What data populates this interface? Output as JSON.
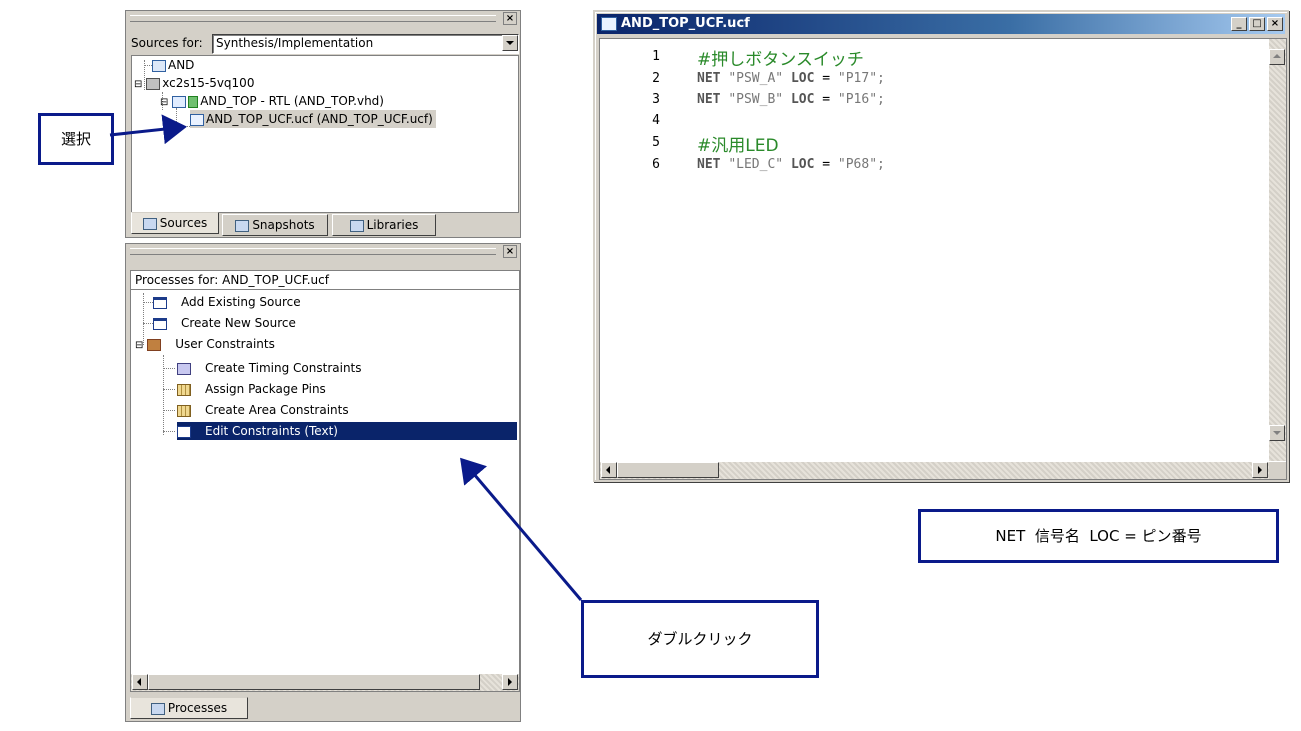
{
  "sources_panel": {
    "sources_for_label": "Sources for:",
    "sources_for_value": "Synthesis/Implementation",
    "tree": [
      {
        "label": "AND",
        "icon": "file-icon"
      },
      {
        "label": "xc2s15-5vq100",
        "icon": "chip-icon"
      },
      {
        "label": "AND_TOP - RTL (AND_TOP.vhd)",
        "icon": "vhdl-module-icon"
      },
      {
        "label": "AND_TOP_UCF.ucf (AND_TOP_UCF.ucf)",
        "icon": "ucf-file-icon",
        "selected": true
      }
    ],
    "tabs": [
      {
        "label": "Sources",
        "icon": "sources-icon",
        "active": true
      },
      {
        "label": "Snapshots",
        "icon": "snapshots-icon"
      },
      {
        "label": "Libraries",
        "icon": "libraries-icon"
      }
    ]
  },
  "processes_panel": {
    "header": "Processes for: AND_TOP_UCF.ucf",
    "items": [
      {
        "label": "Add Existing Source",
        "icon": "window-icon"
      },
      {
        "label": "Create New Source",
        "icon": "window-icon"
      },
      {
        "label": "User Constraints",
        "icon": "tools-icon"
      },
      {
        "label": "Create Timing Constraints",
        "icon": "timing-icon"
      },
      {
        "label": "Assign Package Pins",
        "icon": "grid-icon"
      },
      {
        "label": "Create Area Constraints",
        "icon": "grid-icon"
      },
      {
        "label": "Edit Constraints (Text)",
        "icon": "document-icon",
        "selected": true
      }
    ],
    "tab": "Processes"
  },
  "editor": {
    "title": "AND_TOP_UCF.ucf",
    "lines": [
      {
        "num": "1",
        "text": "#押しボタンスイッチ"
      },
      {
        "num": "2",
        "kw1": "NET",
        "str1": "\"PSW_A\"",
        "kw2": "LOC",
        "eq": "=",
        "str2": "\"P17\";"
      },
      {
        "num": "3",
        "kw1": "NET",
        "str1": "\"PSW_B\"",
        "kw2": "LOC",
        "eq": "=",
        "str2": "\"P16\";"
      },
      {
        "num": "4",
        "text": ""
      },
      {
        "num": "5",
        "text": "#汎用LED"
      },
      {
        "num": "6",
        "kw1": "NET",
        "str1": "\"LED_C\"",
        "kw2": "LOC",
        "eq": "=",
        "str2": "\"P68\";"
      }
    ]
  },
  "callouts": {
    "select": "選択",
    "double_click": "ダブルクリック",
    "syntax": "NET  信号名  LOC = ピン番号"
  },
  "colors": {
    "selection": "#0a246a",
    "callout_border": "#0a1a8a",
    "comment": "#2a8a2a"
  }
}
